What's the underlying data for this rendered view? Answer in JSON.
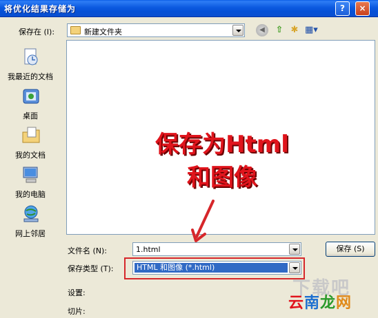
{
  "window": {
    "title": "将优化结果存储为",
    "help_label": "?",
    "close_label": "×"
  },
  "save_in": {
    "label": "保存在 (I):",
    "value": "新建文件夹"
  },
  "toolbar": {
    "icons": [
      "back-icon",
      "up-folder-icon",
      "new-folder-icon",
      "view-menu-icon"
    ]
  },
  "places": [
    {
      "label": "我最近的文档",
      "icon": "recent-documents-icon"
    },
    {
      "label": "桌面",
      "icon": "desktop-icon"
    },
    {
      "label": "我的文档",
      "icon": "my-documents-icon"
    },
    {
      "label": "我的电脑",
      "icon": "my-computer-icon"
    },
    {
      "label": "网上邻居",
      "icon": "network-places-icon"
    }
  ],
  "annotation": {
    "line1": "保存为Html",
    "line2": "和图像",
    "color": "#e0141c"
  },
  "filename": {
    "label": "文件名 (N):",
    "value": "1.html"
  },
  "savetype": {
    "label": "保存类型 (T):",
    "value": "HTML 和图像 (*.html)"
  },
  "buttons": {
    "save": "保存 (S)"
  },
  "settings": {
    "settings_label": "设置:",
    "slices_label": "切片:"
  },
  "watermark": {
    "top": "下载吧",
    "bottom": "云南龙网"
  },
  "colors": {
    "titlebar": "#0c5ae0",
    "dialog_bg": "#ece9d8",
    "selection": "#316ac5",
    "highlight_box": "#d6262a"
  }
}
